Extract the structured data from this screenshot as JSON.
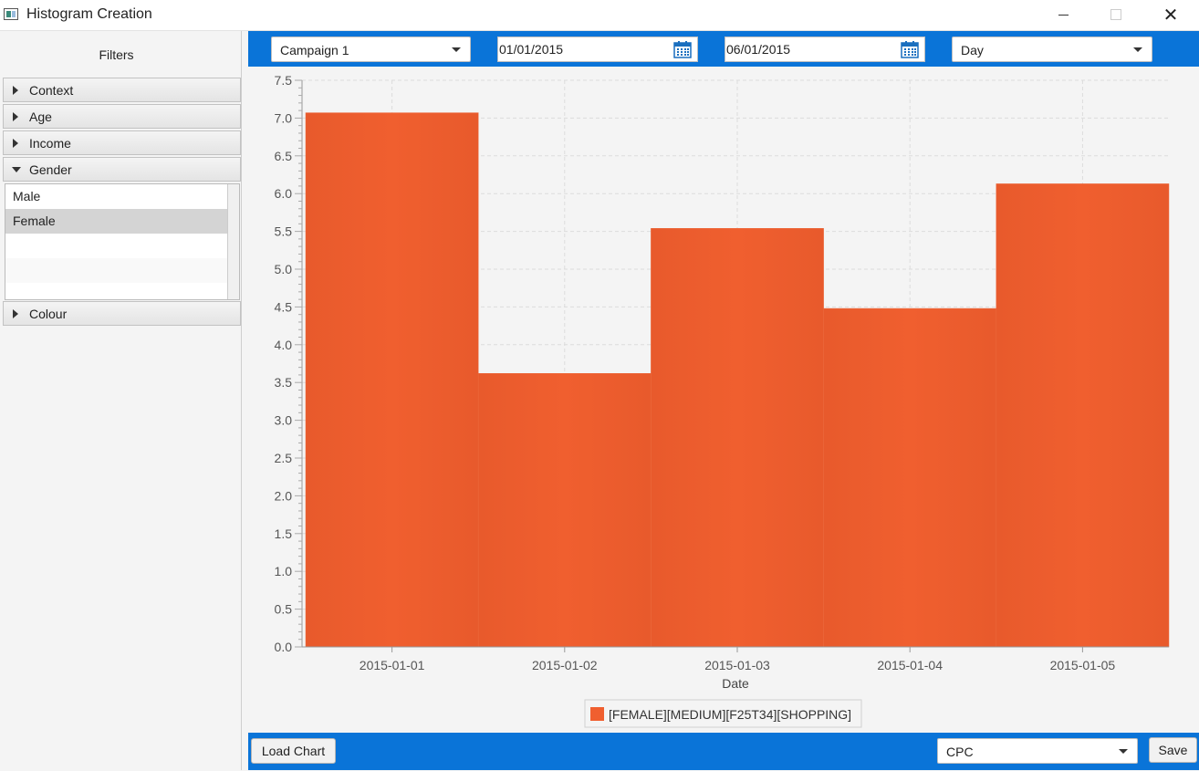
{
  "window": {
    "title": "Histogram Creation"
  },
  "sidebar": {
    "title": "Filters",
    "sections": [
      {
        "label": "Context",
        "expanded": false
      },
      {
        "label": "Age",
        "expanded": false
      },
      {
        "label": "Income",
        "expanded": false
      },
      {
        "label": "Gender",
        "expanded": true
      },
      {
        "label": "Colour",
        "expanded": false
      }
    ],
    "gender_options": [
      {
        "label": "Male",
        "selected": false
      },
      {
        "label": "Female",
        "selected": true
      }
    ]
  },
  "toolbar": {
    "campaign": "Campaign 1",
    "start_date": "01/01/2015",
    "end_date": "06/01/2015",
    "granularity": "Day"
  },
  "bottom": {
    "load_label": "Load Chart",
    "metric": "CPC",
    "save_label": "Save"
  },
  "colors": {
    "accent": "#0a74d8",
    "bar": "#f05f2f"
  },
  "chart_data": {
    "type": "bar",
    "categories": [
      "2015-01-01",
      "2015-01-02",
      "2015-01-03",
      "2015-01-04",
      "2015-01-05"
    ],
    "series": [
      {
        "name": "[FEMALE][MEDIUM][F25T34][SHOPPING]",
        "values": [
          7.07,
          3.62,
          5.54,
          4.48,
          6.13
        ]
      }
    ],
    "xlabel": "Date",
    "ylabel": "",
    "ylim": [
      0,
      7.5
    ],
    "yticks": [
      "0.0",
      "0.5",
      "1.0",
      "1.5",
      "2.0",
      "2.5",
      "3.0",
      "3.5",
      "4.0",
      "4.5",
      "5.0",
      "5.5",
      "6.0",
      "6.5",
      "7.0",
      "7.5"
    ],
    "grid": true,
    "legend": "bottom"
  }
}
